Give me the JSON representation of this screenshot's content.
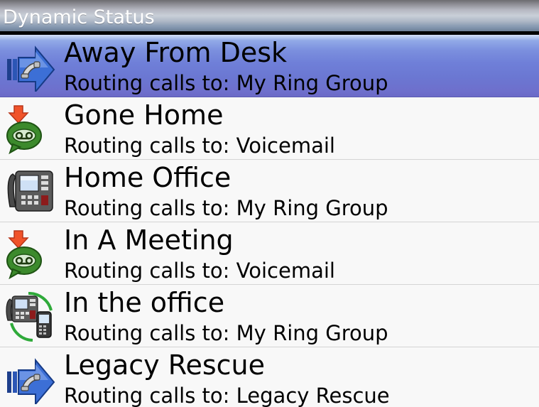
{
  "header": {
    "title": "Dynamic Status"
  },
  "colors": {
    "selected_highlight": "#7180da",
    "row_background": "#f8f8f8",
    "separator": "#d4d4d4"
  },
  "statuses": [
    {
      "name": "Away From Desk",
      "route": "Routing calls to: My Ring Group",
      "icon": "call-forward-icon",
      "selected": true
    },
    {
      "name": "Gone Home",
      "route": "Routing calls to: Voicemail",
      "icon": "voicemail-icon",
      "selected": false
    },
    {
      "name": "Home Office",
      "route": "Routing calls to: My Ring Group",
      "icon": "desk-phone-icon",
      "selected": false
    },
    {
      "name": "In A Meeting",
      "route": "Routing calls to: Voicemail",
      "icon": "voicemail-icon",
      "selected": false
    },
    {
      "name": "In the office",
      "route": "Routing calls to: My Ring Group",
      "icon": "phone-and-mobile-icon",
      "selected": false
    },
    {
      "name": "Legacy Rescue",
      "route": "Routing calls to: Legacy Rescue",
      "icon": "call-forward-icon",
      "selected": false
    }
  ]
}
